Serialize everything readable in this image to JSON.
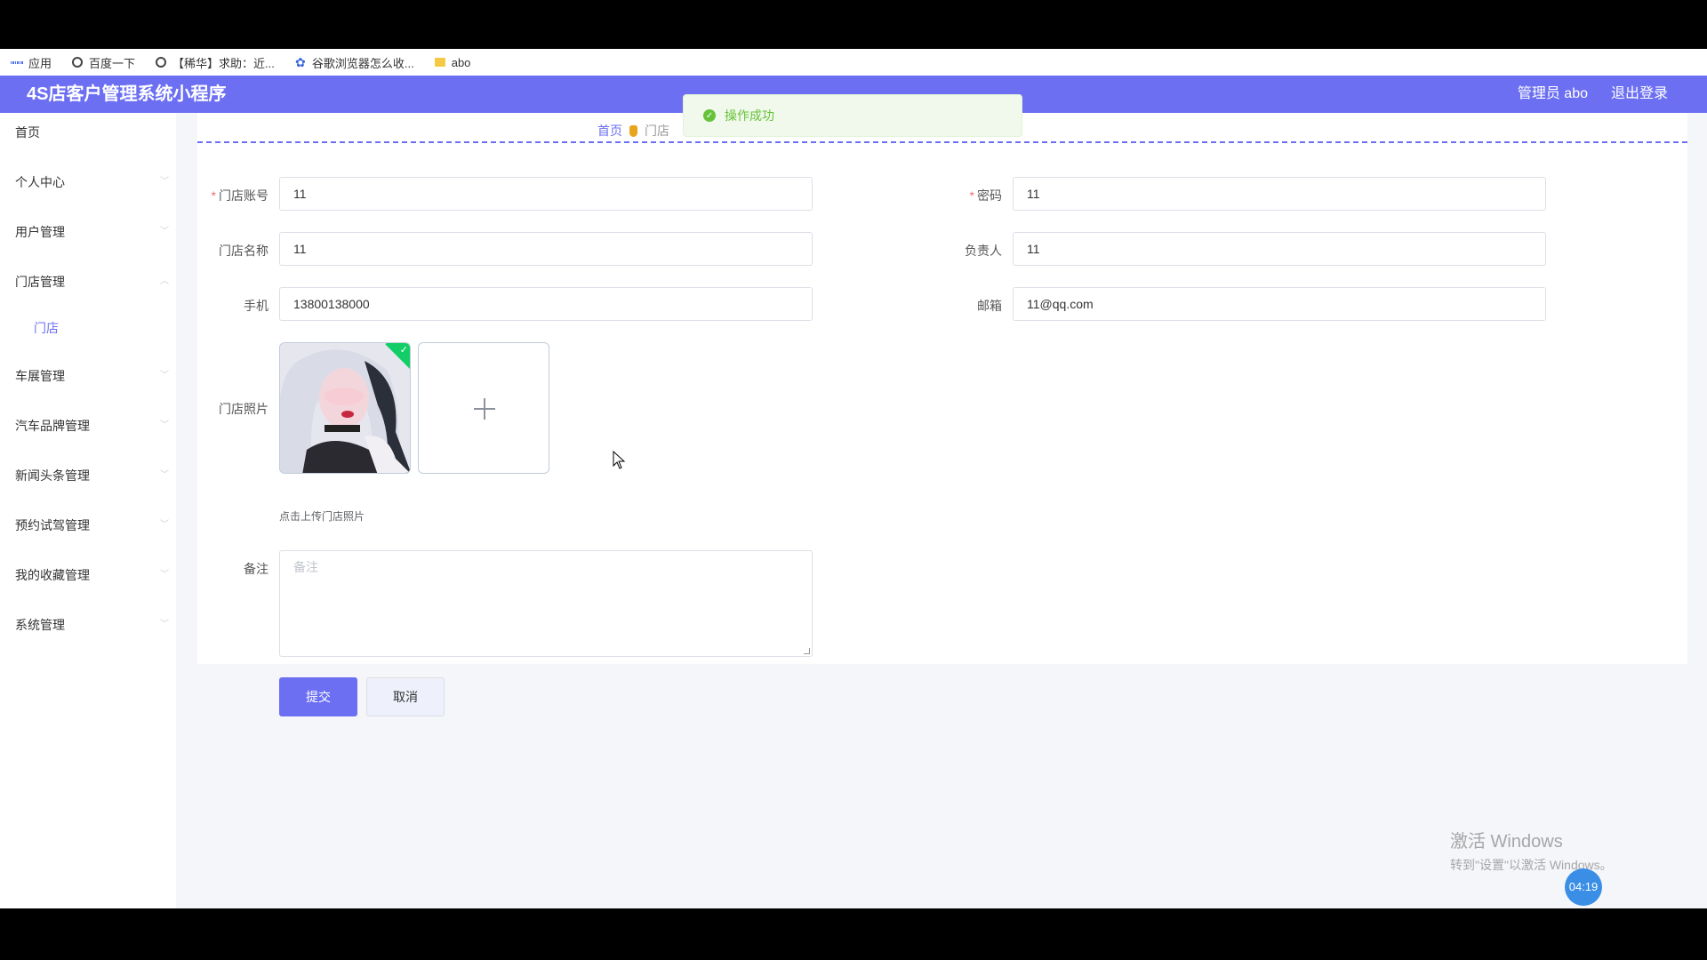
{
  "bookmarks": [
    {
      "label": "应用",
      "icon": "apps-grid-icon"
    },
    {
      "label": "百度一下",
      "icon": "globe-icon"
    },
    {
      "label": "【稀华】求助：近...",
      "icon": "globe-icon"
    },
    {
      "label": "谷歌浏览器怎么收...",
      "icon": "baidu-paw-icon"
    },
    {
      "label": "abo",
      "icon": "folder-icon"
    }
  ],
  "header": {
    "title": "4S店客户管理系统小程序",
    "user": "管理员 abo",
    "logout": "退出登录"
  },
  "sidebar": {
    "items": [
      {
        "label": "首页"
      },
      {
        "label": "个人中心"
      },
      {
        "label": "用户管理"
      },
      {
        "label": "门店管理"
      },
      {
        "label": "门店"
      },
      {
        "label": "车展管理"
      },
      {
        "label": "汽车品牌管理"
      },
      {
        "label": "新闻头条管理"
      },
      {
        "label": "预约试驾管理"
      },
      {
        "label": "我的收藏管理"
      },
      {
        "label": "系统管理"
      }
    ]
  },
  "breadcrumb": {
    "home": "首页",
    "current": "门店"
  },
  "form": {
    "account": {
      "label": "门店账号",
      "value": "11"
    },
    "password": {
      "label": "密码",
      "value": "11"
    },
    "name": {
      "label": "门店名称",
      "value": "11"
    },
    "manager": {
      "label": "负责人",
      "value": "11"
    },
    "phone": {
      "label": "手机",
      "value": "13800138000"
    },
    "email": {
      "label": "邮箱",
      "value": "11@qq.com"
    },
    "photo": {
      "label": "门店照片",
      "hint": "点击上传门店照片"
    },
    "remark": {
      "label": "备注",
      "placeholder": "备注"
    },
    "submit": "提交",
    "cancel": "取消"
  },
  "toast": {
    "message": "操作成功"
  },
  "watermark": {
    "line1": "激活 Windows",
    "line2": "转到\"设置\"以激活 Windows。"
  },
  "timer": "04:19",
  "colors": {
    "primary": "#6c6ff2",
    "success": "#67c23a",
    "required": "#f56c6c"
  }
}
